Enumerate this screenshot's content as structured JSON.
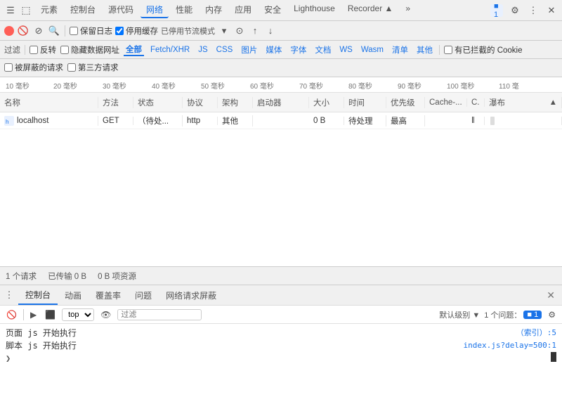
{
  "tabs": {
    "items": [
      "元素",
      "控制台",
      "源代码",
      "网络",
      "性能",
      "内存",
      "应用",
      "安全",
      "Lighthouse",
      "Recorder ▲",
      "»"
    ],
    "active": "网络"
  },
  "toolbar": {
    "preserve_log": "保留日志",
    "disable_cache": "停用缓存",
    "offline_mode": "已停用节流模式",
    "record_icon": "●",
    "stop_icon": "🚫",
    "filter_icon": "⊘",
    "search_icon": "🔍",
    "import_icon": "↓",
    "export_icon": "↑",
    "settings_icon": "⚙"
  },
  "filter": {
    "label": "过滤",
    "invert": "反转",
    "hide_data_urls": "隐藏数据网址",
    "all": "全部",
    "tags": [
      "Fetch/XHR",
      "JS",
      "CSS",
      "图片",
      "媒体",
      "字体",
      "文档",
      "WS",
      "Wasm",
      "清单",
      "其他"
    ],
    "has_blocked_cookies": "有已拦截的 Cookie",
    "blocked_requests": "被屏蔽的请求",
    "third_party": "第三方请求"
  },
  "ruler": {
    "ticks": [
      "10 毫秒",
      "20 毫秒",
      "30 毫秒",
      "40 毫秒",
      "50 毫秒",
      "60 毫秒",
      "70 毫秒",
      "80 毫秒",
      "90 毫秒",
      "100 毫秒",
      "110 毫"
    ]
  },
  "table": {
    "headers": [
      "名称",
      "方法",
      "状态",
      "协议",
      "架构",
      "启动器",
      "大小",
      "时间",
      "优先级",
      "Cache-...",
      "C.",
      "瀑布"
    ],
    "rows": [
      {
        "name": "localhost",
        "method": "GET",
        "status": "（待处...",
        "protocol": "http",
        "type": "其他",
        "initiator": "",
        "size": "0 B",
        "time": "待处理",
        "priority": "最高",
        "cache": "",
        "c": "‖",
        "waterfall": true
      }
    ]
  },
  "status_bar": {
    "requests": "1 个请求",
    "transferred": "已传输 0 B",
    "resources": "0 B 项资源"
  },
  "bottom_tabs": [
    "控制台",
    "动画",
    "覆盖率",
    "问题",
    "网络请求屏蔽"
  ],
  "console": {
    "top_label": "top",
    "filter_placeholder": "过滤",
    "level_label": "默认级别 ▼",
    "issues_label": "1 个问题：",
    "issues_count": "■ 1",
    "lines": [
      {
        "text": "页面 js 开始执行",
        "right": "（索引）:5"
      },
      {
        "text": "脚本 js 开始执行",
        "right": "index.js?delay=500:1"
      }
    ]
  },
  "icons": {
    "settings": "⚙",
    "more": "⋮",
    "close": "✕",
    "chevron": "▾",
    "play": "▶",
    "stop": "⬛",
    "ban": "🚫",
    "dock": "⊞"
  }
}
